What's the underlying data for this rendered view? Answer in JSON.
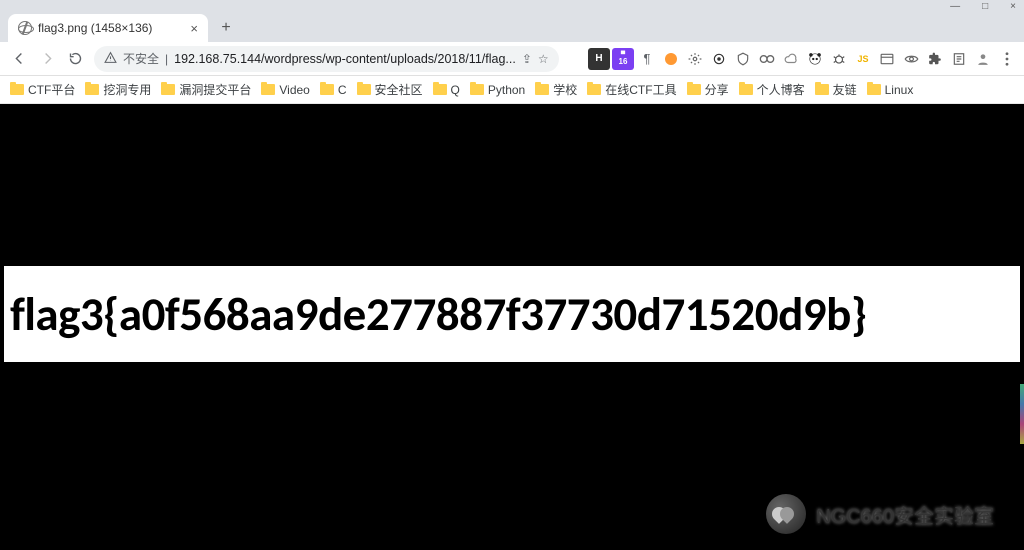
{
  "window": {
    "min": "—",
    "max": "□",
    "close": "×"
  },
  "tab": {
    "title": "flag3.png (1458×136)",
    "close": "×",
    "new": "+"
  },
  "toolbar": {
    "security_label": "不安全",
    "url": "192.168.75.144/wordpress/wp-content/uploads/2018/11/flag...",
    "share": "⇪",
    "star": "☆",
    "ext_h": "H",
    "ext_cal": "16",
    "ext_para": "¶"
  },
  "bookmarks": [
    {
      "label": "CTF平台"
    },
    {
      "label": "挖洞专用"
    },
    {
      "label": "漏洞提交平台"
    },
    {
      "label": "Video"
    },
    {
      "label": "C"
    },
    {
      "label": "安全社区"
    },
    {
      "label": "Q"
    },
    {
      "label": "Python"
    },
    {
      "label": "学校"
    },
    {
      "label": "在线CTF工具"
    },
    {
      "label": "分享"
    },
    {
      "label": "个人博客"
    },
    {
      "label": "友链"
    },
    {
      "label": "Linux"
    }
  ],
  "content": {
    "flag": "flag3{a0f568aa9de277887f37730d71520d9b}"
  },
  "watermark": {
    "text": "NGC660安全实验室"
  }
}
